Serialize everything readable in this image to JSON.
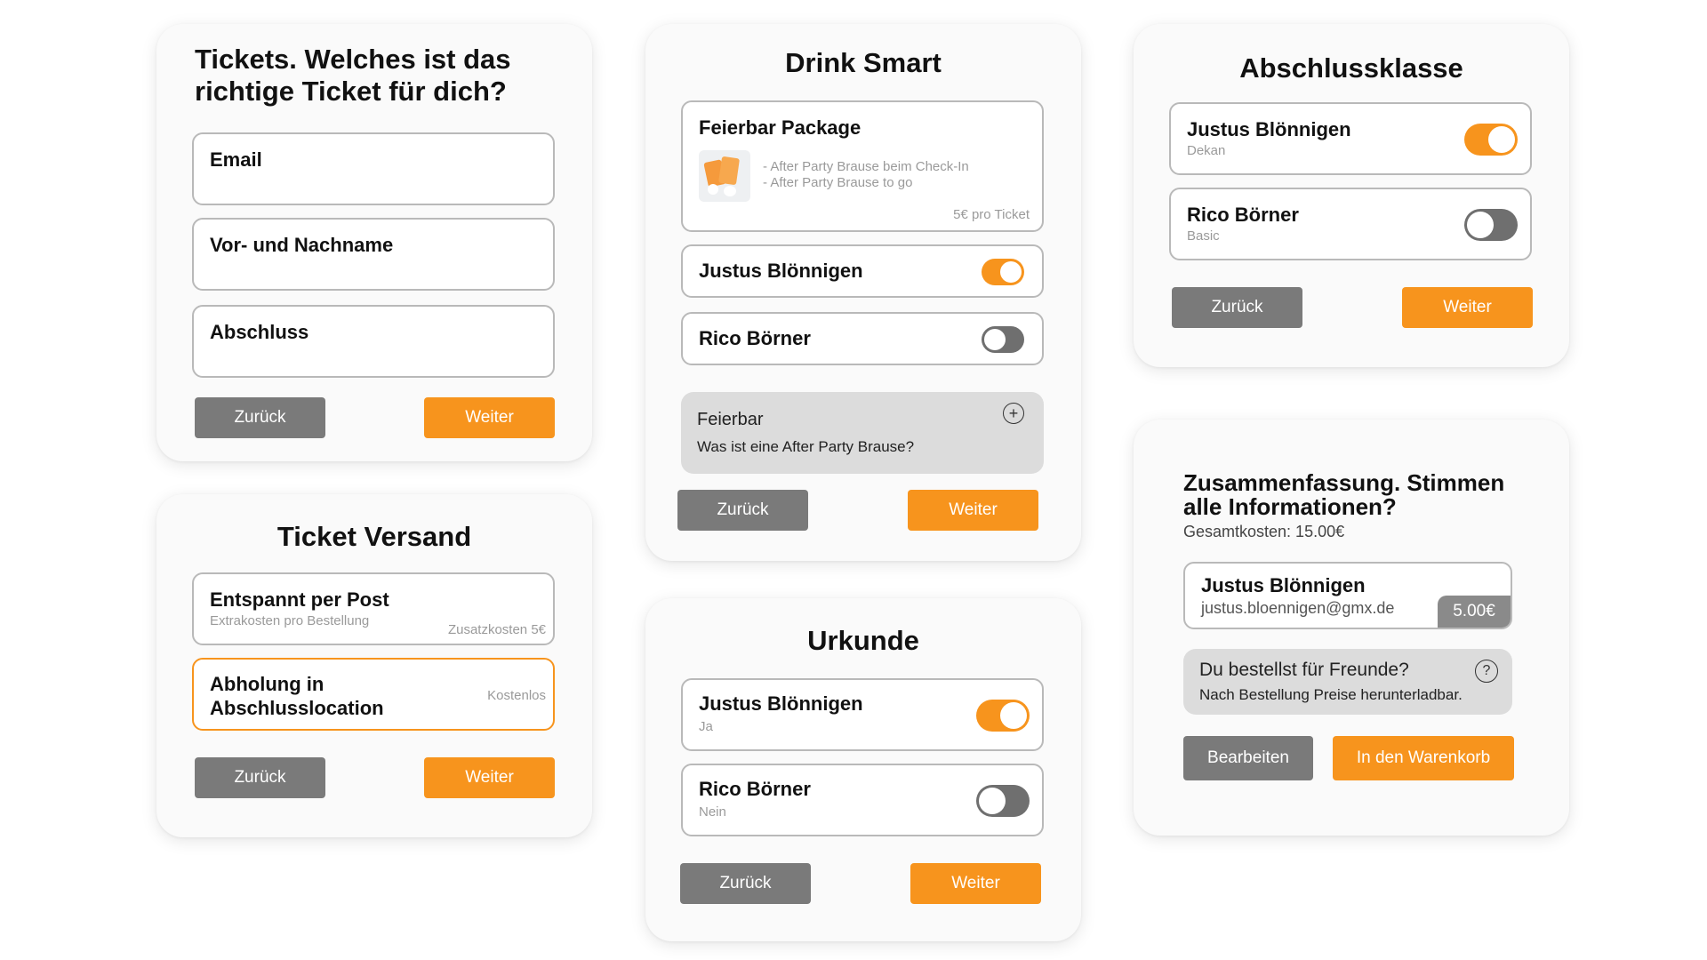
{
  "card_tickets": {
    "title": "Tickets. Welches ist das richtige Ticket für dich?",
    "fields": [
      "Email",
      "Vor- und Nachname",
      "Abschluss"
    ],
    "back_label": "Zurück",
    "next_label": "Weiter"
  },
  "card_versand": {
    "title": "Ticket Versand",
    "option1": {
      "label": "Entspannt per Post",
      "sub": "Extrakosten pro Bestellung",
      "price": "Zusatzkosten 5€"
    },
    "option2": {
      "label": "Abholung in Abschlusslocation",
      "price": "Kostenlos"
    },
    "back_label": "Zurück",
    "next_label": "Weiter"
  },
  "card_drink": {
    "title": "Drink Smart",
    "package": {
      "title": "Feierbar Package",
      "line1": "- After Party Brause beim Check-In",
      "line2": "- After Party Brause to go",
      "price": "5€ pro Ticket"
    },
    "persons": [
      {
        "name": "Justus Blönnigen",
        "enabled": true
      },
      {
        "name": "Rico Börner",
        "enabled": false
      }
    ],
    "info": {
      "title": "Feierbar",
      "text": "Was ist eine After Party Brause?",
      "icon": "plus-circle-icon"
    },
    "back_label": "Zurück",
    "next_label": "Weiter"
  },
  "card_urkunde": {
    "title": "Urkunde",
    "persons": [
      {
        "name": "Justus Blönnigen",
        "sub": "Ja",
        "enabled": true
      },
      {
        "name": "Rico Börner",
        "sub": "Nein",
        "enabled": false
      }
    ],
    "back_label": "Zurück",
    "next_label": "Weiter"
  },
  "card_klasse": {
    "title": "Abschlussklasse",
    "persons": [
      {
        "name": "Justus Blönnigen",
        "sub": "Dekan",
        "enabled": true
      },
      {
        "name": "Rico Börner",
        "sub": "Basic",
        "enabled": false
      }
    ],
    "back_label": "Zurück",
    "next_label": "Weiter"
  },
  "card_summary": {
    "title": "Zusammenfassung. Stimmen alle Informationen?",
    "total": "Gesamtkosten: 15.00€",
    "person": {
      "name": "Justus Blönnigen",
      "email": "justus.bloennigen@gmx.de",
      "price": "5.00€"
    },
    "info": {
      "title": "Du bestellst für Freunde?",
      "text": "Nach Bestellung Preise herunterladbar.",
      "icon": "question-circle-icon"
    },
    "edit_label": "Bearbeiten",
    "cart_label": "In den Warenkorb"
  },
  "colors": {
    "accent": "#f7941d",
    "button_gray": "#7a7a7a",
    "info_bg": "#dcdcdc"
  }
}
